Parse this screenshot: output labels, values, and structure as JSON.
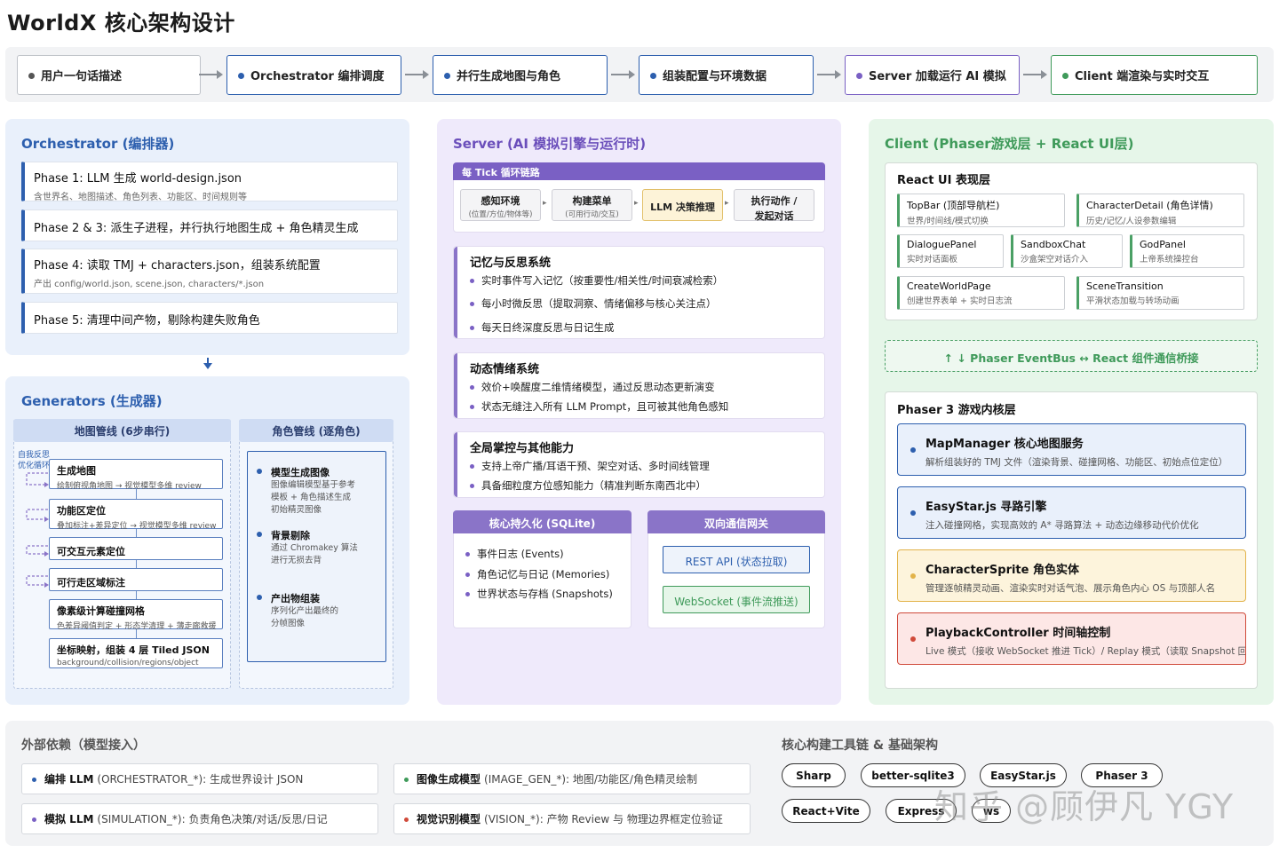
{
  "title": "WorldX 核心架构设计",
  "flow": {
    "steps": [
      "用户一句话描述",
      "Orchestrator 编排调度",
      "并行生成地图与角色",
      "组装配置与环境数据",
      "Server 加载运行 AI 模拟",
      "Client 端渲染与实时交互"
    ],
    "dot_colors": [
      "#555555",
      "#2d5fae",
      "#2d5fae",
      "#2d5fae",
      "#7a60c4",
      "#3f9a5a"
    ]
  },
  "orchestrator": {
    "title": "Orchestrator (编排器)",
    "phases": [
      {
        "title": "Phase 1: LLM 生成 world-design.json",
        "sub": "含世界名、地图描述、角色列表、功能区、时间规则等"
      },
      {
        "title": "Phase 2 & 3: 派生子进程，并行执行地图生成 + 角色精灵生成",
        "sub": ""
      },
      {
        "title": "Phase 4: 读取 TMJ + characters.json，组装系统配置",
        "sub": "产出 config/world.json, scene.json, characters/*.json"
      },
      {
        "title": "Phase 5: 清理中间产物，剔除构建失败角色",
        "sub": ""
      }
    ]
  },
  "generators": {
    "title": "Generators (生成器)",
    "map_pipeline": {
      "title": "地图管线 (6步串行)",
      "retry_label": "自我反思\n优化循环",
      "steps": [
        {
          "title": "生成地图",
          "sub": "绘制俯视角地图 → 视觉模型多维 review"
        },
        {
          "title": "功能区定位",
          "sub": "叠加标注+差异定位 → 视觉模型多维 review"
        },
        {
          "title": "可交互元素定位",
          "sub": ""
        },
        {
          "title": "可行走区域标注",
          "sub": ""
        },
        {
          "title": "像素级计算碰撞网格",
          "sub": "色差异阈值判定 + 形态学清理 + 薄走廊救援"
        },
        {
          "title": "坐标映射，组装 4 层 Tiled JSON",
          "sub": "background/collision/regions/object"
        }
      ]
    },
    "role_pipeline": {
      "title": "角色管线 (逐角色)",
      "items": [
        {
          "title": "模型生成图像",
          "sub": [
            "图像编辑模型基于参考",
            "模板 + 角色描述生成",
            "初始精灵图像"
          ]
        },
        {
          "title": "背景剔除",
          "sub": [
            "通过 Chromakey 算法",
            "进行无损去背"
          ]
        },
        {
          "title": "产出物组装",
          "sub": [
            "序列化产出最终的",
            "分帧图像"
          ]
        }
      ]
    }
  },
  "server": {
    "title": "Server (AI 模拟引擎与运行时)",
    "tick": {
      "title": "每 Tick 循环链路",
      "steps": [
        {
          "title": "感知环境",
          "sub": "(位置/方位/物体等)"
        },
        {
          "title": "构建菜单",
          "sub": "(可用行动/交互)"
        },
        {
          "title": "LLM 决策推理",
          "sub": ""
        },
        {
          "title": "执行动作 /",
          "sub2": "发起对话"
        }
      ]
    },
    "memory": {
      "title": "记忆与反思系统",
      "items": [
        "实时事件写入记忆（按重要性/相关性/时间衰减检索）",
        "每小时微反思（提取洞察、情绪偏移与核心关注点）",
        "每天日终深度反思与日记生成"
      ]
    },
    "emotion": {
      "title": "动态情绪系统",
      "items": [
        "效价+唤醒度二维情绪模型，通过反思动态更新演变",
        "状态无缝注入所有 LLM Prompt，且可被其他角色感知"
      ]
    },
    "global": {
      "title": "全局掌控与其他能力",
      "items": [
        "支持上帝广播/耳语干预、架空对话、多时间线管理",
        "具备细粒度方位感知能力（精准判断东南西北中）"
      ]
    },
    "persistence": {
      "title": "核心持久化 (SQLite)",
      "items": [
        "事件日志 (Events)",
        "角色记忆与日记 (Memories)",
        "世界状态与存档 (Snapshots)"
      ]
    },
    "gateway": {
      "title": "双向通信网关",
      "rest": "REST API (状态拉取)",
      "ws": "WebSocket (事件流推送)"
    }
  },
  "client": {
    "title": "Client (Phaser游戏层 + React UI层)",
    "react": {
      "title": "React UI 表现层",
      "tiles": [
        {
          "title": "TopBar (顶部导航栏)",
          "sub": "世界/时间线/模式切换"
        },
        {
          "title": "CharacterDetail (角色详情)",
          "sub": "历史/记忆/人设参数编辑"
        },
        {
          "title": "DialoguePanel",
          "sub": "实时对话面板"
        },
        {
          "title": "SandboxChat",
          "sub": "沙盒架空对话介入"
        },
        {
          "title": "GodPanel",
          "sub": "上帝系统操控台"
        },
        {
          "title": "CreateWorldPage",
          "sub": "创建世界表单 + 实时日志流"
        },
        {
          "title": "SceneTransition",
          "sub": "平滑状态加载与转场动画"
        }
      ]
    },
    "bridge": "↑ ↓ Phaser EventBus ↔ React 组件通信桥接",
    "phaser": {
      "title": "Phaser 3 游戏内核层",
      "cards": [
        {
          "title": "MapManager 核心地图服务",
          "sub": "解析组装好的 TMJ 文件（渲染背景、碰撞网格、功能区、初始点位定位）"
        },
        {
          "title": "EasyStar.js 寻路引擎",
          "sub": "注入碰撞网格，实现高效的 A* 寻路算法 + 动态边缘移动代价优化"
        },
        {
          "title": "CharacterSprite 角色实体",
          "sub": "管理逐帧精灵动画、渲染实时对话气泡、展示角色内心 OS 与顶部人名"
        },
        {
          "title": "PlaybackController 时间轴控制",
          "sub": "Live 模式（接收 WebSocket 推进 Tick）/ Replay 模式（读取 Snapshot 回放）"
        }
      ]
    }
  },
  "external": {
    "title": "外部依赖（模型接入）",
    "deps": [
      {
        "name": "编排 LLM",
        "desc": "(ORCHESTRATOR_*): 生成世界设计 JSON",
        "color": "#2d5fae"
      },
      {
        "name": "图像生成模型",
        "desc": "(IMAGE_GEN_*): 地图/功能区/角色精灵绘制",
        "color": "#3f9a5a"
      },
      {
        "name": "模拟 LLM",
        "desc": "(SIMULATION_*): 负责角色决策/对话/反思/日记",
        "color": "#7a60c4"
      },
      {
        "name": "视觉识别模型",
        "desc": "(VISION_*): 产物 Review 与 物理边界框定位验证",
        "color": "#d04a3a"
      }
    ]
  },
  "toolchain": {
    "title": "核心构建工具链 & 基础架构",
    "pills": [
      "Sharp",
      "better-sqlite3",
      "EasyStar.js",
      "Phaser 3",
      "React+Vite",
      "Express",
      "ws"
    ]
  },
  "watermark": "知乎 @顾伊凡 YGY"
}
